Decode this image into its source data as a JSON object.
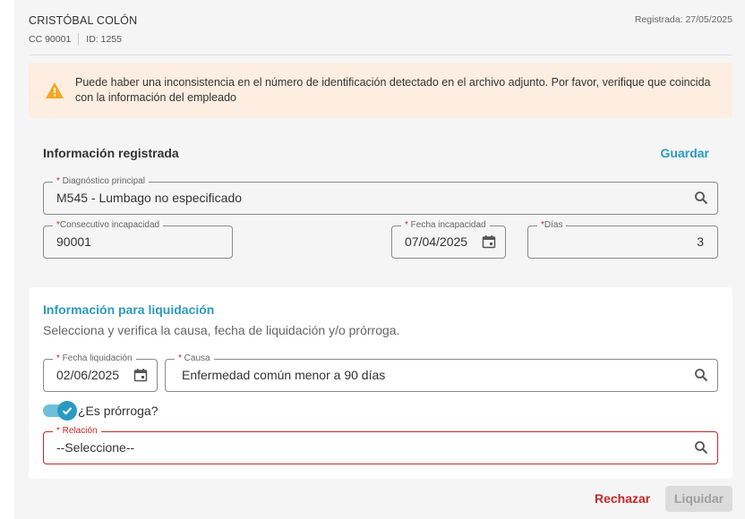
{
  "employee": {
    "name": "CRISTÓBAL COLÓN",
    "document": "CC 90001",
    "id": "ID: 1255",
    "registered": "Registrada: 27/05/2025"
  },
  "alert": {
    "icon": "warning-icon",
    "color": "#f5a623",
    "message": "Puede haber una inconsistencia en el número de identificación detectado en el archivo adjunto. Por favor, verifique que coincida con la información del empleado"
  },
  "registered_info": {
    "title": "Información registrada",
    "save_label": "Guardar",
    "diagnosis": {
      "label": "Diagnóstico principal",
      "value": "M545 - Lumbago no especificado"
    },
    "consecutive": {
      "label": "Consecutivo incapacidad",
      "value": "90001"
    },
    "incapacity_date": {
      "label": "Fecha incapacidad",
      "value": "07/04/2025"
    },
    "days": {
      "label": "Días",
      "value": "3"
    }
  },
  "settlement_info": {
    "title": "Información para liquidación",
    "subtitle": "Selecciona y verifica la causa, fecha de liquidación y/o prórroga.",
    "settlement_date": {
      "label": "Fecha liquidación",
      "value": "02/06/2025"
    },
    "cause": {
      "label": "Causa",
      "value": "Enfermedad común menor a 90 días"
    },
    "extension": {
      "label": "¿Es prórroga?",
      "checked": true
    },
    "relation": {
      "label": "Relación",
      "value": "--Seleccione--"
    }
  },
  "actions": {
    "reject_label": "Rechazar",
    "settle_label": "Liquidar"
  },
  "colors": {
    "accent": "#2a9ac3",
    "error": "#c62828",
    "alert_bg": "#fdeee1"
  }
}
